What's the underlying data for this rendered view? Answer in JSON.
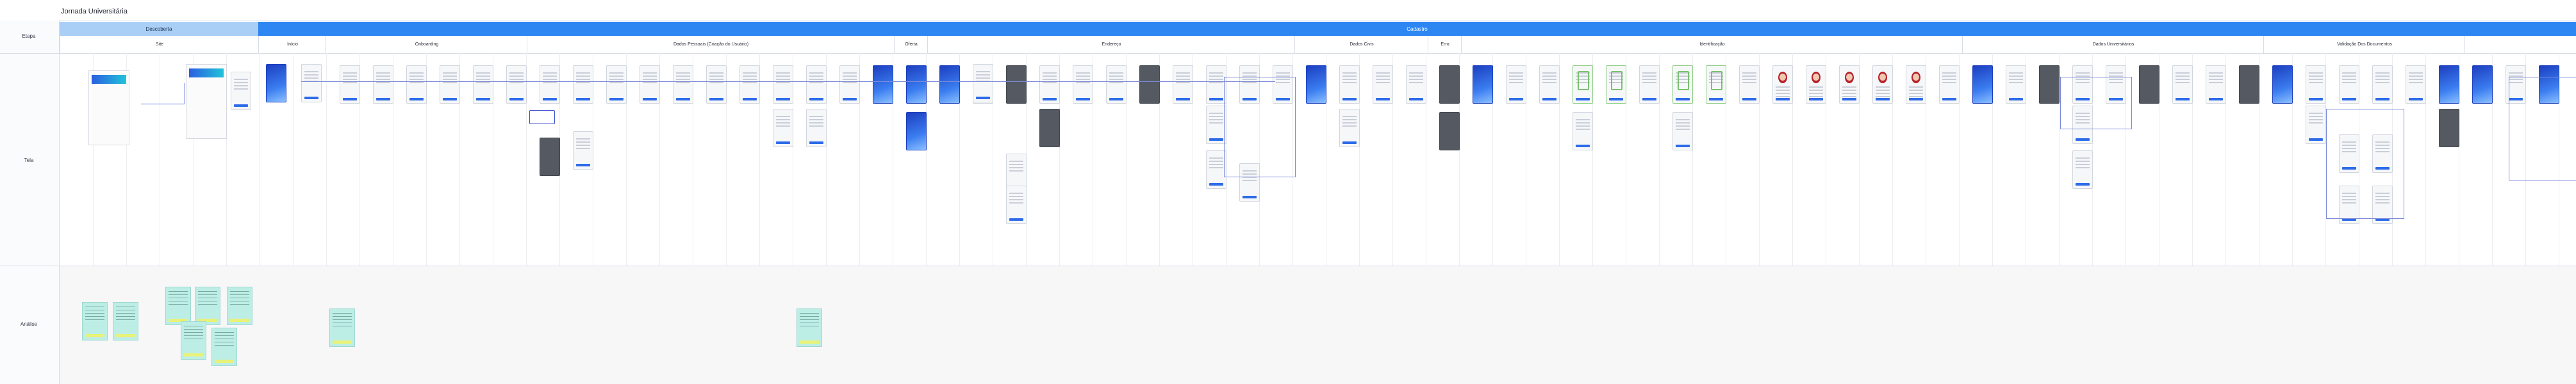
{
  "board": {
    "title": "Jornada Universitária"
  },
  "rows": {
    "etapa": "Etapa",
    "tela": "Tela",
    "analise": "Análise"
  },
  "stages": [
    {
      "name": "Descoberta"
    },
    {
      "name": "Cadastro"
    }
  ],
  "phases": [
    {
      "name": "Site"
    },
    {
      "name": "Início"
    },
    {
      "name": "Onboarding"
    },
    {
      "name": "Dados Pessoais (Criação do Usuário)"
    },
    {
      "name": "Oferta"
    },
    {
      "name": "Endereço"
    },
    {
      "name": "Dados Civis"
    },
    {
      "name": "Erro"
    },
    {
      "name": "Identificação"
    },
    {
      "name": "Dados Universitários"
    },
    {
      "name": "Validação Dos Documentos"
    }
  ]
}
